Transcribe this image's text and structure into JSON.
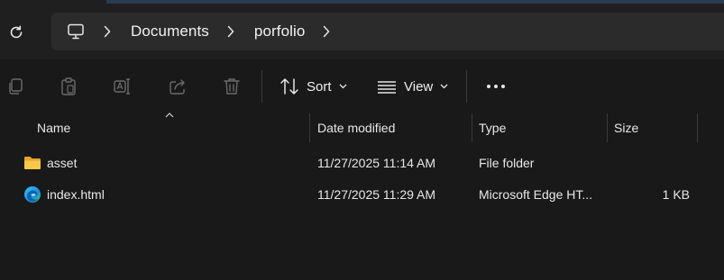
{
  "window": {
    "accent_color": "#2a3a55"
  },
  "address_bar": {
    "breadcrumbs": [
      "Documents",
      "porfolio"
    ]
  },
  "command_bar": {
    "sort_label": "Sort",
    "view_label": "View"
  },
  "columns": {
    "name": "Name",
    "date_modified": "Date modified",
    "type": "Type",
    "size": "Size"
  },
  "files": [
    {
      "icon": "folder-icon",
      "name": "asset",
      "date_modified": "11/27/2025 11:14 AM",
      "type": "File folder",
      "size": ""
    },
    {
      "icon": "edge-icon",
      "name": "index.html",
      "date_modified": "11/27/2025 11:29 AM",
      "type": "Microsoft Edge HT...",
      "size": "1 KB"
    }
  ]
}
